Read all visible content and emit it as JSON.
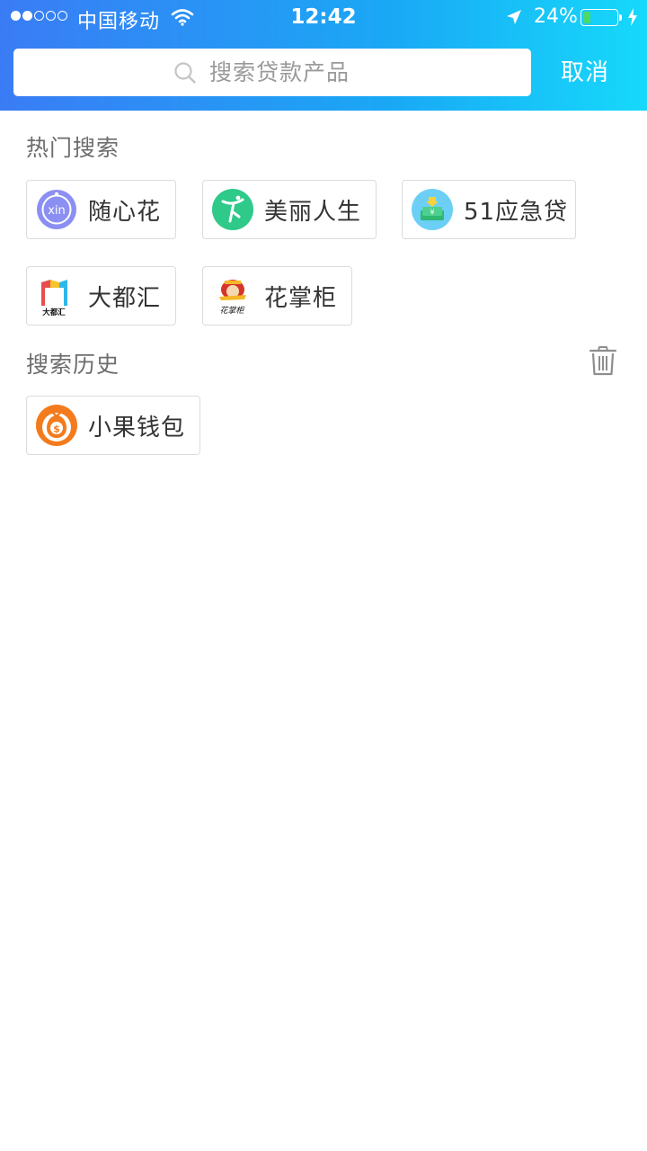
{
  "status_bar": {
    "carrier": "中国移动",
    "time": "12:42",
    "battery_percent": "24%",
    "battery_level": 0.24,
    "battery_fill_color": "#4cd964",
    "signal_strength": 2,
    "icons": [
      "signal-dots",
      "wifi-icon",
      "location-arrow-icon",
      "battery-icon",
      "charging-bolt-icon"
    ]
  },
  "search": {
    "placeholder": "搜索贷款产品",
    "value": "",
    "cancel_label": "取消"
  },
  "hot_search": {
    "title": "热门搜索",
    "items": [
      {
        "label": "随心花",
        "icon": "suixinhua-logo-icon",
        "icon_label": "xin",
        "color": "#8b8ff2"
      },
      {
        "label": "美丽人生",
        "icon": "meilirensheng-logo-icon",
        "color": "#2fc98a"
      },
      {
        "label": "51应急贷",
        "icon": "yingjidai-logo-icon",
        "color": "#6ccff6"
      },
      {
        "label": "大都汇",
        "icon": "daduhui-logo-icon",
        "icon_label": "大都汇",
        "color": "#e94e4e"
      },
      {
        "label": "花掌柜",
        "icon": "huazhanggui-logo-icon",
        "icon_label": "花掌柜",
        "color": "#d6352b"
      }
    ]
  },
  "history": {
    "title": "搜索历史",
    "clear_icon": "trash-icon",
    "items": [
      {
        "label": "小果钱包",
        "icon": "xiaoguoqianbao-logo-icon",
        "icon_label": "$",
        "color": "#f37b1d"
      }
    ]
  },
  "colors": {
    "header_gradient_start": "#3a7cf5",
    "header_gradient_end": "#16d9fb",
    "section_title": "#6d6d6d",
    "chip_border": "#dcdcdc"
  }
}
